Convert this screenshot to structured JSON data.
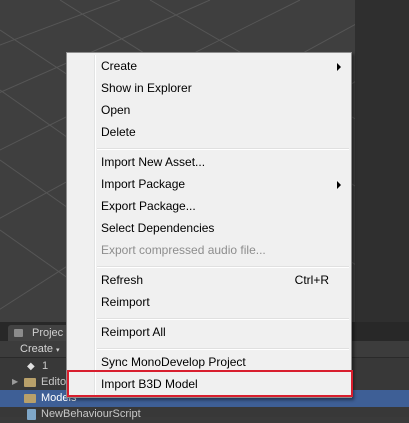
{
  "colors": {
    "highlight_border": "#d81e2e",
    "selected_row": "#3e5f96"
  },
  "project_panel": {
    "tab_label": "Projec",
    "create_label": "Create",
    "create_caret": "▾",
    "tree": [
      {
        "icon": "unity-icon",
        "label": "1"
      },
      {
        "icon": "folder-icon",
        "label": "Editor"
      },
      {
        "icon": "folder-icon",
        "label": "Models",
        "selected": true
      },
      {
        "icon": "script-icon",
        "label": "NewBehaviourScript"
      }
    ]
  },
  "menu": {
    "items": [
      {
        "label": "Create",
        "submenu": true
      },
      {
        "label": "Show in Explorer"
      },
      {
        "label": "Open"
      },
      {
        "label": "Delete"
      },
      {
        "label": "Import New Asset..."
      },
      {
        "label": "Import Package",
        "submenu": true
      },
      {
        "label": "Export Package..."
      },
      {
        "label": "Select Dependencies"
      },
      {
        "label": "Export compressed audio file...",
        "disabled": true
      },
      {
        "label": "Refresh",
        "shortcut": "Ctrl+R"
      },
      {
        "label": "Reimport"
      },
      {
        "label": "Reimport All"
      },
      {
        "label": "Sync MonoDevelop Project"
      },
      {
        "label": "Import B3D Model",
        "highlighted": true
      }
    ]
  }
}
